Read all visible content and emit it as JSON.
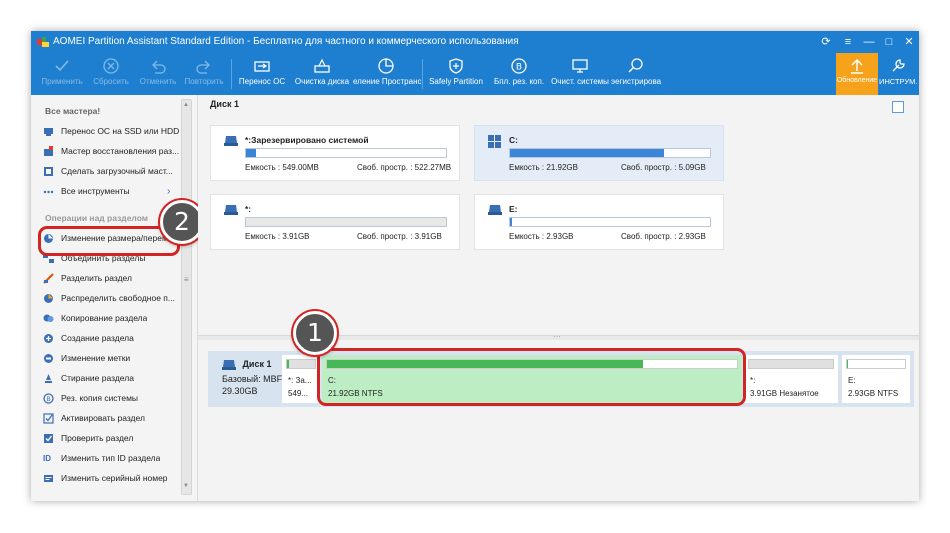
{
  "window": {
    "title": "AOMEI Partition Assistant Standard Edition - Бесплатно для частного и коммерческого использования"
  },
  "toolbar": {
    "apply": "Применить",
    "discard": "Сбросить",
    "undo": "Отменить",
    "redo": "Повторить",
    "migrate_os": "Перенос ОС",
    "wipe_disk": "Очистка диска",
    "allocate_space": "еление Пространс",
    "safely_partition": "Safely Partition",
    "backup": "Бпл. рез. коп.",
    "cleanup": "Очист. системы",
    "register": "эегистрирова",
    "update": "Обновление",
    "tools": "ИНСТРУМ."
  },
  "sidebar": {
    "wizards_header": "Все мастера!",
    "wizards": [
      "Перенос ОС на SSD или HDD",
      "Мастер восстановления раз...",
      "Сделать загрузочный маст...",
      "Все инструменты"
    ],
    "ops_header": "Операции над разделом",
    "ops": [
      "Изменение размера/переме...",
      "Объединить разделы",
      "Разделить раздел",
      "Распределить свободное п...",
      "Копирование раздела",
      "Создание раздела",
      "Изменение метки",
      "Стирание раздела",
      "Рез. копия системы",
      "Активировать раздел",
      "Проверить раздел",
      "Изменить тип ID раздела",
      "Изменить серийный номер"
    ]
  },
  "disk": {
    "title": "Диск 1",
    "partitions": [
      {
        "name": "*:Зарезервировано системой",
        "capacity": "Емкость : 549.00MB",
        "free": "Своб. простр. : 522.27MB",
        "used_fraction": 0.05
      },
      {
        "name": "C:",
        "capacity": "Емкость : 21.92GB",
        "free": "Своб. простр. : 5.09GB",
        "used_fraction": 0.77
      },
      {
        "name": "*:",
        "capacity": "Емкость : 3.91GB",
        "free": "Своб. простр. : 3.91GB",
        "used_fraction": 0.0
      },
      {
        "name": "E:",
        "capacity": "Емкость : 2.93GB",
        "free": "Своб. простр. : 2.93GB",
        "used_fraction": 0.01
      }
    ]
  },
  "diskmap": {
    "name": "Диск 1",
    "type": "Базовый: MBF",
    "size": "29.30GB",
    "segments": [
      {
        "name": "*: За...",
        "info": "549...",
        "used_fraction": 0.05
      },
      {
        "name": "C:",
        "info": "21.92GB NTFS",
        "used_fraction": 0.77
      },
      {
        "name": "*:",
        "info": "3.91GB Незанятое",
        "used_fraction": 0.0
      },
      {
        "name": "E:",
        "info": "2.93GB NTFS",
        "used_fraction": 0.01
      }
    ]
  },
  "callouts": {
    "one": "1",
    "two": "2"
  },
  "colors": {
    "titlebar": "#1e7fd1",
    "accent_update": "#f7a21b",
    "callout": "#d32424",
    "used_bar": "#3b86d9",
    "map_used": "#46b856"
  }
}
